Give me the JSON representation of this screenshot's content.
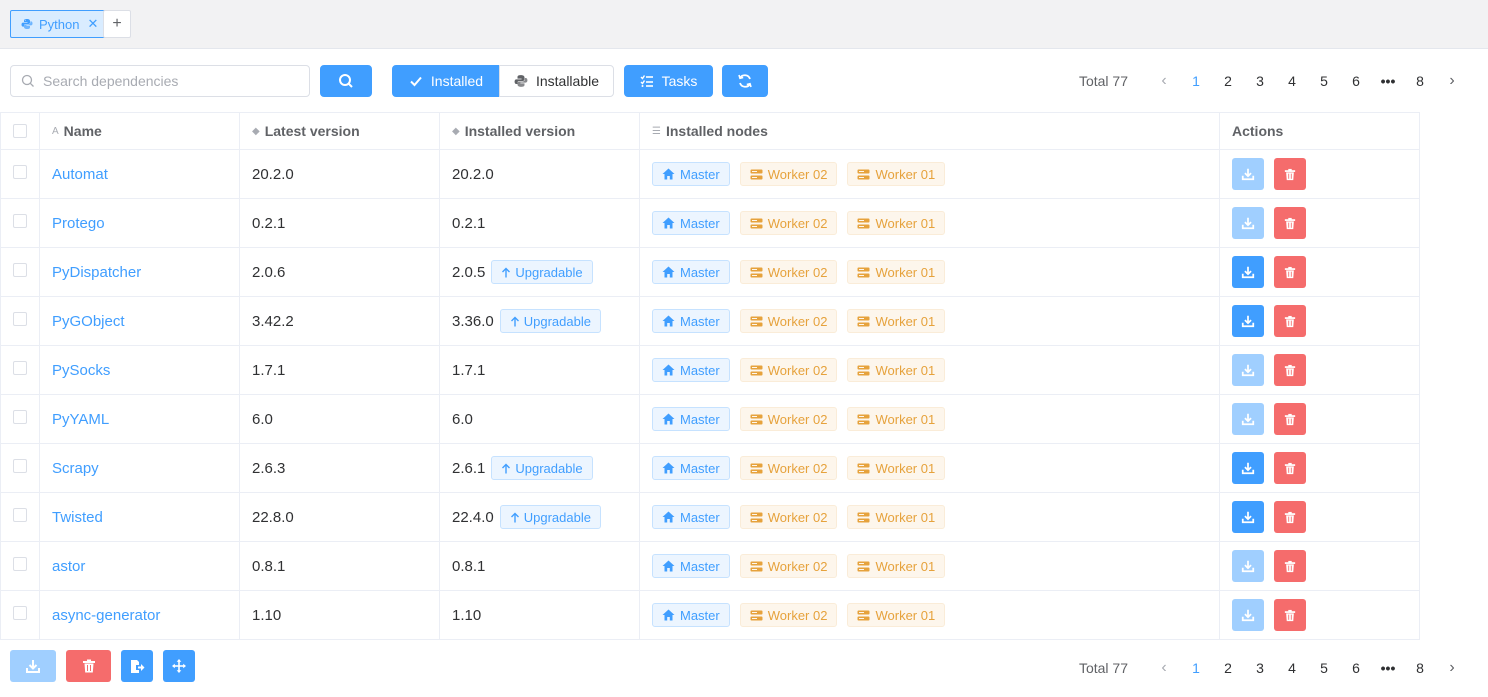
{
  "tabs": [
    {
      "label": "Python"
    }
  ],
  "search": {
    "placeholder": "Search dependencies",
    "value": ""
  },
  "toolbar": {
    "installed_label": "Installed",
    "installable_label": "Installable",
    "tasks_label": "Tasks"
  },
  "pagination": {
    "total_label": "Total 77",
    "pages": [
      "1",
      "2",
      "3",
      "4",
      "5",
      "6",
      "•••",
      "8"
    ],
    "current": "1"
  },
  "table": {
    "columns": [
      "Name",
      "Latest version",
      "Installed version",
      "Installed nodes",
      "Actions"
    ],
    "upgrade_label": "Upgradable",
    "rows": [
      {
        "name": "Automat",
        "latest": "20.2.0",
        "installed": "20.2.0",
        "upgradable": false,
        "nodes": [
          "Master",
          "Worker 02",
          "Worker 01"
        ]
      },
      {
        "name": "Protego",
        "latest": "0.2.1",
        "installed": "0.2.1",
        "upgradable": false,
        "nodes": [
          "Master",
          "Worker 02",
          "Worker 01"
        ]
      },
      {
        "name": "PyDispatcher",
        "latest": "2.0.6",
        "installed": "2.0.5",
        "upgradable": true,
        "nodes": [
          "Master",
          "Worker 02",
          "Worker 01"
        ]
      },
      {
        "name": "PyGObject",
        "latest": "3.42.2",
        "installed": "3.36.0",
        "upgradable": true,
        "nodes": [
          "Master",
          "Worker 02",
          "Worker 01"
        ]
      },
      {
        "name": "PySocks",
        "latest": "1.7.1",
        "installed": "1.7.1",
        "upgradable": false,
        "nodes": [
          "Master",
          "Worker 02",
          "Worker 01"
        ]
      },
      {
        "name": "PyYAML",
        "latest": "6.0",
        "installed": "6.0",
        "upgradable": false,
        "nodes": [
          "Master",
          "Worker 02",
          "Worker 01"
        ]
      },
      {
        "name": "Scrapy",
        "latest": "2.6.3",
        "installed": "2.6.1",
        "upgradable": true,
        "nodes": [
          "Master",
          "Worker 02",
          "Worker 01"
        ]
      },
      {
        "name": "Twisted",
        "latest": "22.8.0",
        "installed": "22.4.0",
        "upgradable": true,
        "nodes": [
          "Master",
          "Worker 02",
          "Worker 01"
        ]
      },
      {
        "name": "astor",
        "latest": "0.8.1",
        "installed": "0.8.1",
        "upgradable": false,
        "nodes": [
          "Master",
          "Worker 02",
          "Worker 01"
        ]
      },
      {
        "name": "async-generator",
        "latest": "1.10",
        "installed": "1.10",
        "upgradable": false,
        "nodes": [
          "Master",
          "Worker 02",
          "Worker 01"
        ]
      }
    ]
  },
  "colors": {
    "primary": "#409eff",
    "primary_disabled": "#a0cfff",
    "danger": "#f56c6c",
    "warning": "#e6a23c"
  },
  "icons": [
    "python-icon",
    "close-icon",
    "plus-icon",
    "search-icon",
    "check-icon",
    "python-logo-icon",
    "task-list-icon",
    "refresh-icon",
    "home-icon",
    "server-icon",
    "download-icon",
    "trash-icon",
    "arrow-up-icon",
    "tag-icon",
    "export-icon",
    "move-icon"
  ]
}
